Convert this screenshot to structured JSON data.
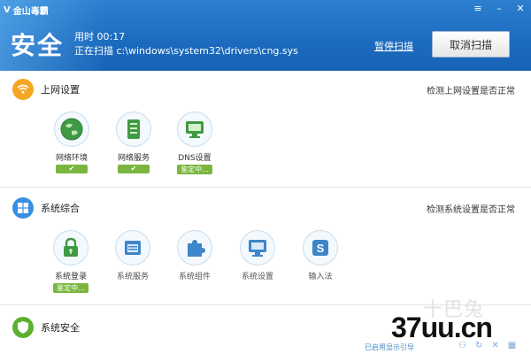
{
  "app": {
    "name": "金山毒霸",
    "logo_mark": "V"
  },
  "window_controls": {
    "menu": "≡",
    "minimize": "–",
    "close": "✕"
  },
  "scan": {
    "status": "安全",
    "elapsed_label": "用时",
    "elapsed": "00:17",
    "scanning_label": "正在扫描",
    "path": "c:\\windows\\system32\\drivers\\cng.sys",
    "pause_label": "暂停扫描",
    "cancel_label": "取消扫描"
  },
  "sections": [
    {
      "title": "上网设置",
      "right": "检测上网设置是否正常",
      "icon_color": "#f5a623",
      "icon": "wifi-icon",
      "items": [
        {
          "label": "网络环境",
          "status": "ok",
          "status_text": "✔",
          "icon": "globe-icon"
        },
        {
          "label": "网络服务",
          "status": "ok",
          "status_text": "✔",
          "icon": "server-icon"
        },
        {
          "label": "DNS设置",
          "status": "checking",
          "status_text": "鉴定中...",
          "icon": "monitor-icon"
        }
      ]
    },
    {
      "title": "系统综合",
      "right": "检测系统设置是否正常",
      "icon_color": "#3a8fe0",
      "icon": "windows-icon",
      "items": [
        {
          "label": "系统登录",
          "status": "checking",
          "status_text": "鉴定中...",
          "icon": "lock-icon"
        },
        {
          "label": "系统服务",
          "status": "",
          "status_text": "",
          "icon": "window-icon"
        },
        {
          "label": "系统组件",
          "status": "",
          "status_text": "",
          "icon": "puzzle-icon"
        },
        {
          "label": "系统设置",
          "status": "",
          "status_text": "",
          "icon": "settings-monitor-icon"
        },
        {
          "label": "输入法",
          "status": "",
          "status_text": "",
          "icon": "input-s-icon"
        }
      ]
    },
    {
      "title": "系统安全",
      "right": "",
      "icon_color": "#5bb030",
      "icon": "shield-icon",
      "items": []
    }
  ],
  "watermark": {
    "faint": "十巴兔",
    "bold": "37uu.cn"
  },
  "footer": {
    "link": "已启用显示引导"
  },
  "colors": {
    "header": "#1d6cc1",
    "accent": "#7ab63e",
    "circle_border": "#c8dced"
  }
}
